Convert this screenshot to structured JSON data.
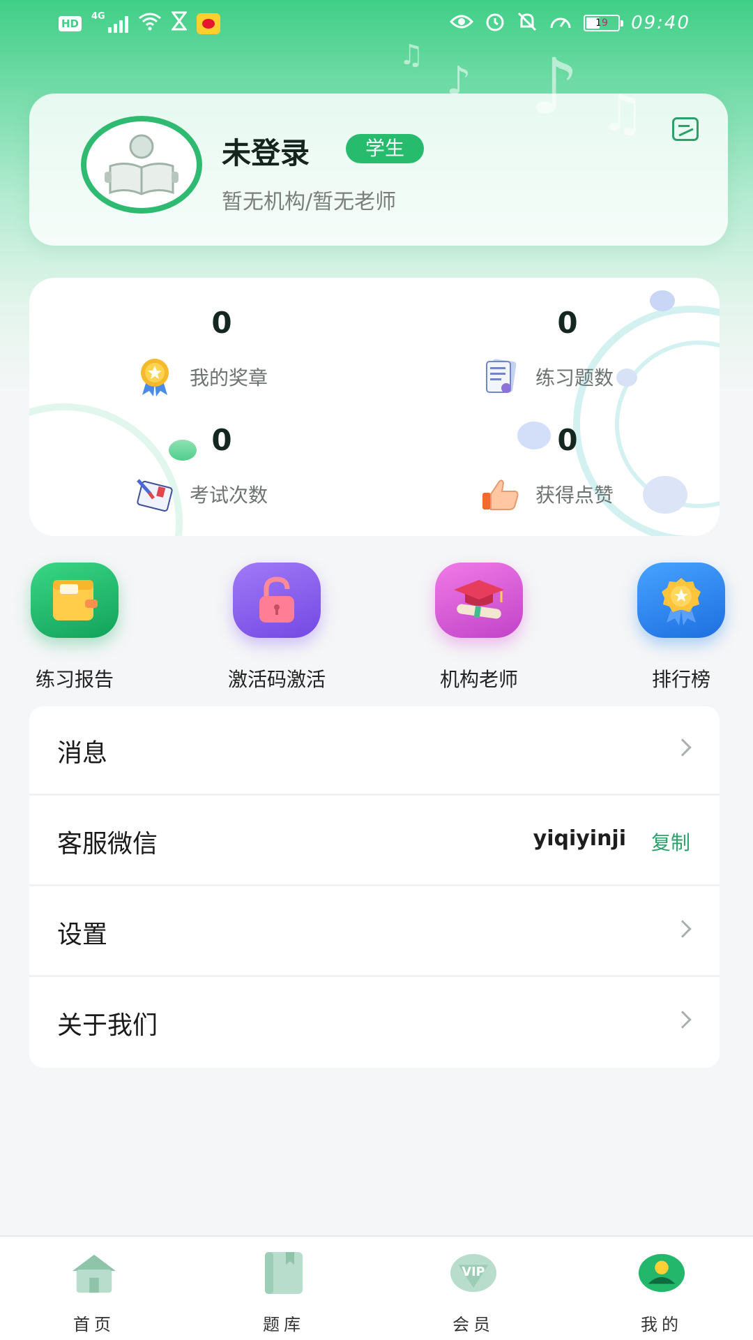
{
  "status_bar": {
    "network_badge": "HD",
    "network_type": "4G",
    "battery_level": "19",
    "time": "09:40"
  },
  "profile": {
    "name": "未登录",
    "role_badge": "学生",
    "subtitle": "暂无机构/暂无老师"
  },
  "stats": [
    {
      "value": "0",
      "label": "我的奖章",
      "icon": "medal-icon"
    },
    {
      "value": "0",
      "label": "练习题数",
      "icon": "document-icon"
    },
    {
      "value": "0",
      "label": "考试次数",
      "icon": "exam-book-icon"
    },
    {
      "value": "0",
      "label": "获得点赞",
      "icon": "thumbs-up-icon"
    }
  ],
  "quick_actions": [
    {
      "label": "练习报告",
      "icon": "notebook-icon",
      "color": "#1fb56a"
    },
    {
      "label": "激活码激活",
      "icon": "unlock-icon",
      "color": "#8a5cf0"
    },
    {
      "label": "机构老师",
      "icon": "graduation-cap-icon",
      "color": "#d650d8"
    },
    {
      "label": "排行榜",
      "icon": "ranking-medal-icon",
      "color": "#2a86f0"
    }
  ],
  "menu": {
    "messages": "消息",
    "wechat_label": "客服微信",
    "wechat_id": "yiqiyinji",
    "copy": "复制",
    "settings": "设置",
    "about": "关于我们"
  },
  "tabs": [
    {
      "label": "首页",
      "icon": "home-icon"
    },
    {
      "label": "题库",
      "icon": "book-icon"
    },
    {
      "label": "会员",
      "icon": "vip-icon"
    },
    {
      "label": "我的",
      "icon": "profile-icon"
    }
  ],
  "colors": {
    "accent": "#27bb6e",
    "header_green": "#3fcf86"
  }
}
